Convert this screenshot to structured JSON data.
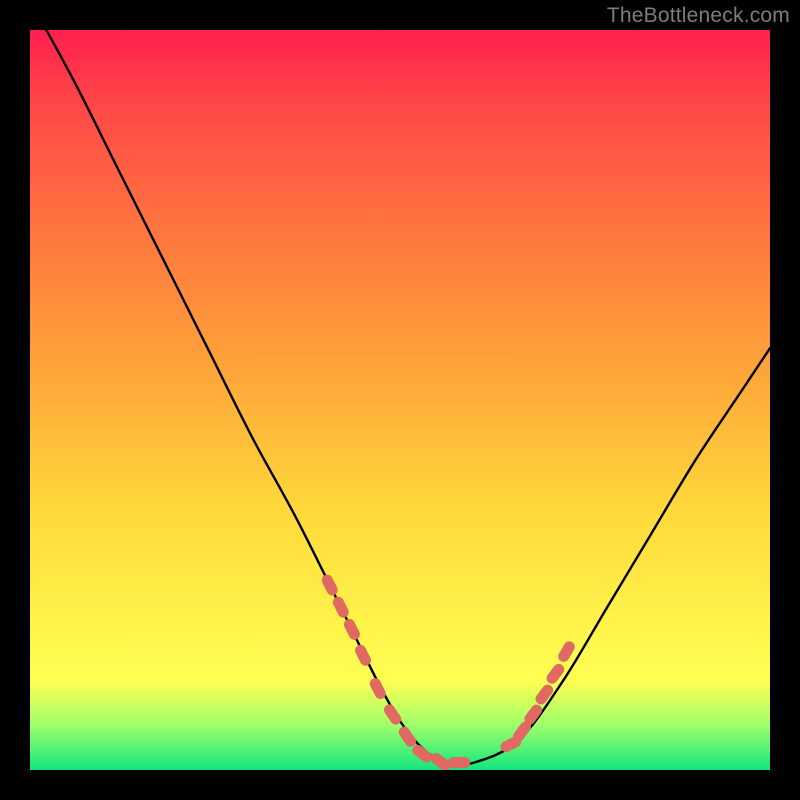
{
  "watermark": "TheBottleneck.com",
  "chart_data": {
    "type": "line",
    "title": "",
    "xlabel": "",
    "ylabel": "",
    "xlim": [
      0,
      100
    ],
    "ylim": [
      0,
      100
    ],
    "series": [
      {
        "name": "bottleneck-curve",
        "x": [
          0,
          6,
          12,
          18,
          24,
          30,
          36,
          42,
          48,
          52,
          56,
          60,
          66,
          72,
          78,
          84,
          90,
          96,
          100
        ],
        "y": [
          104,
          93,
          81,
          69,
          57,
          45,
          34,
          22,
          10,
          4,
          1,
          1,
          4,
          12,
          22,
          32,
          42,
          51,
          57
        ]
      }
    ],
    "markers": [
      {
        "name": "left-cluster",
        "x": [
          40.5,
          42,
          43.5,
          45,
          47,
          49,
          51,
          53,
          55.5,
          58
        ],
        "y": [
          25,
          22,
          19,
          15.5,
          11,
          7.5,
          4.5,
          2.2,
          1.1,
          1.0
        ]
      },
      {
        "name": "right-cluster",
        "x": [
          65,
          66.5,
          68,
          69.5,
          71,
          72.5
        ],
        "y": [
          3.5,
          5.2,
          7.5,
          10.2,
          13,
          16
        ]
      }
    ]
  }
}
